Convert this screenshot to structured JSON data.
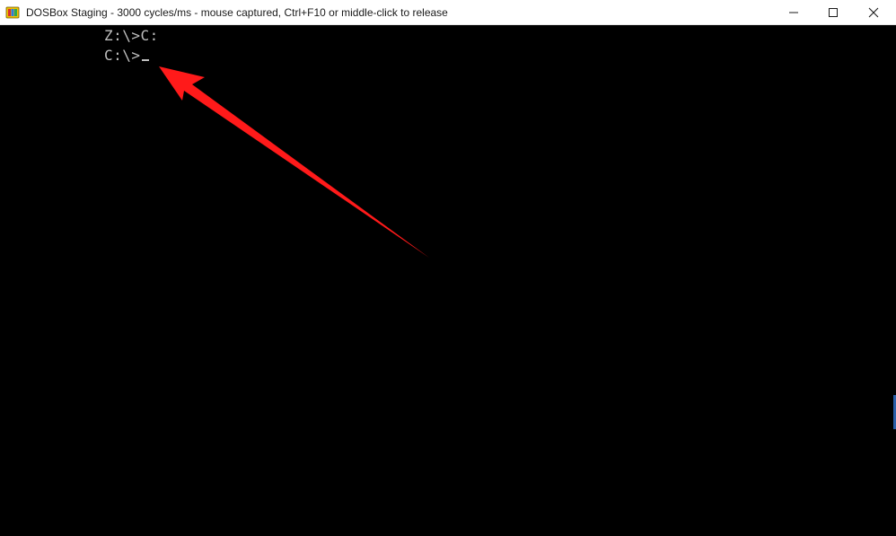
{
  "window": {
    "title": "DOSBox Staging - 3000 cycles/ms - mouse captured, Ctrl+F10 or middle-click to release",
    "app_icon": "dosbox-icon",
    "controls": {
      "minimize_icon": "minimize-icon",
      "maximize_icon": "maximize-icon",
      "close_icon": "close-icon"
    }
  },
  "console": {
    "lines": [
      "Z:\\>C:",
      "C:\\>"
    ],
    "cursor": "_",
    "text_color": "#c0c0c0",
    "background": "#000000"
  },
  "annotation": {
    "type": "arrow",
    "color": "#ff1a1a",
    "points_to": "console-line-2"
  }
}
